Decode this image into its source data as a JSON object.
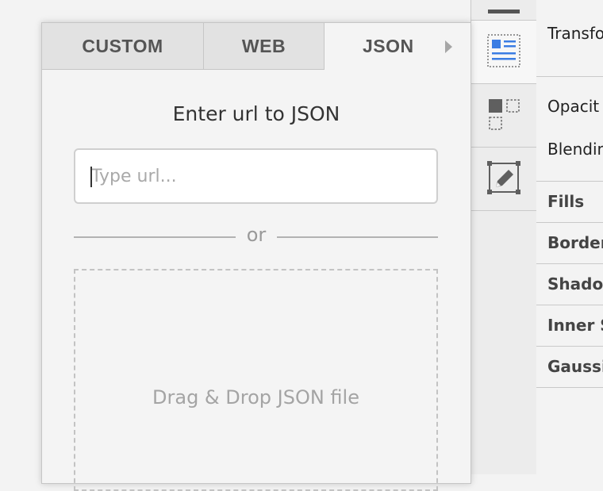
{
  "popover": {
    "tabs": [
      {
        "label": "CUSTOM"
      },
      {
        "label": "WEB"
      },
      {
        "label": "JSON"
      }
    ],
    "active_tab": "JSON",
    "heading": "Enter url to JSON",
    "url_input": {
      "value": "",
      "placeholder": "Type url..."
    },
    "separator_text": "or",
    "dropzone_text": "Drag & Drop JSON file"
  },
  "toolstrip": {
    "icons": [
      "inspector-tab-icon",
      "layout-list-icon",
      "align-objects-icon",
      "edit-shape-icon"
    ],
    "selected": "layout-list-icon"
  },
  "inspector": {
    "rows": [
      {
        "label": "Transfo"
      },
      {
        "label": "Opacit"
      },
      {
        "label": "Blendin"
      },
      {
        "label": "Fills"
      },
      {
        "label": "Border"
      },
      {
        "label": "Shado"
      },
      {
        "label": "Inner S"
      },
      {
        "label": "Gaussi"
      }
    ]
  },
  "colors": {
    "accent_blue": "#3b7de3",
    "border": "#c6c6c6",
    "icon_gray": "#5f5f5f"
  }
}
